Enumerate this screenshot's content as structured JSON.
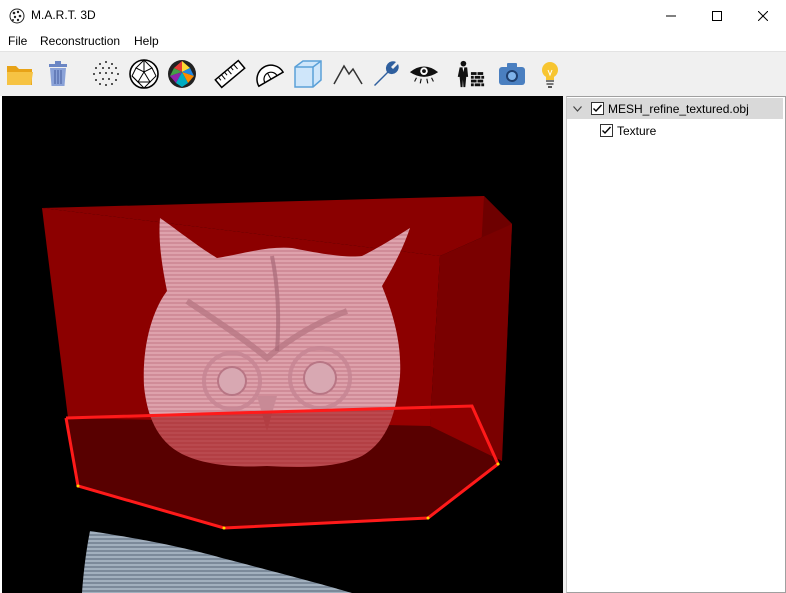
{
  "window": {
    "title": "M.A.R.T. 3D",
    "controls": [
      "minimize",
      "maximize",
      "close"
    ]
  },
  "menu": {
    "items": [
      {
        "label": "File"
      },
      {
        "label": "Reconstruction"
      },
      {
        "label": "Help"
      }
    ]
  },
  "toolbar": {
    "tools": [
      {
        "icon": "folder-open-icon"
      },
      {
        "icon": "trash-icon"
      },
      {
        "icon": "point-cloud-icon"
      },
      {
        "icon": "wireframe-sphere-icon"
      },
      {
        "icon": "colored-sphere-icon"
      },
      {
        "icon": "ruler-icon"
      },
      {
        "icon": "protractor-icon"
      },
      {
        "icon": "cube-icon"
      },
      {
        "icon": "mountain-icon"
      },
      {
        "icon": "wrench-icon"
      },
      {
        "icon": "eye-icon"
      },
      {
        "icon": "person-wall-icon"
      },
      {
        "icon": "camera-icon"
      },
      {
        "icon": "lightbulb-icon"
      }
    ]
  },
  "scene_tree": {
    "items": [
      {
        "label": "MESH_refine_textured.obj",
        "checked": true,
        "expanded": true,
        "selected": true
      },
      {
        "label": "Texture",
        "checked": true
      }
    ]
  },
  "viewport": {
    "background": "#000000",
    "selection_color": "#ff0000",
    "mesh_color": "#e8a0b0"
  }
}
